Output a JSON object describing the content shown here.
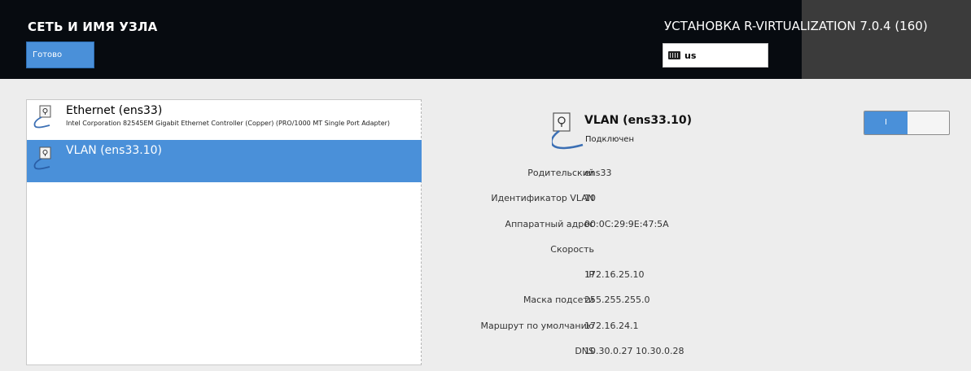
{
  "header": {
    "title": "СЕТЬ И ИМЯ УЗЛА",
    "done_label": "Готово",
    "install_title": "УСТАНОВКА R-VIRTUALIZATION 7.0.4 (160)",
    "keyboard_layout": "us"
  },
  "devices": [
    {
      "name": "Ethernet (ens33)",
      "description": "Intel Corporation 82545EM Gigabit Ethernet Controller (Copper) (PRO/1000 MT Single Port Adapter)"
    },
    {
      "name": "VLAN (ens33.10)",
      "description": ""
    }
  ],
  "selected_device": {
    "name": "VLAN (ens33.10)",
    "status": "Подключен",
    "toggle_label": "I",
    "toggle_on": true,
    "properties": [
      {
        "label": "Родительский",
        "value": "ens33"
      },
      {
        "label": "Идентификатор VLAN",
        "value": "10"
      },
      {
        "label": "Аппаратный адрес",
        "value": "00:0C:29:9E:47:5A"
      },
      {
        "label": "Скорость",
        "value": ""
      },
      {
        "label": "IP",
        "value": "172.16.25.10"
      },
      {
        "label": "Маска подсети",
        "value": "255.255.255.0"
      },
      {
        "label": "Маршрут по умолчанию",
        "value": "172.16.24.1"
      },
      {
        "label": "DNS",
        "value": "10.30.0.27 10.30.0.28"
      }
    ]
  },
  "colors": {
    "header_bg": "#070b10",
    "accent": "#4a90d9",
    "page_bg": "#ededed"
  },
  "icons": {
    "keyboard": "keyboard-icon",
    "network": "network-cable-icon"
  }
}
